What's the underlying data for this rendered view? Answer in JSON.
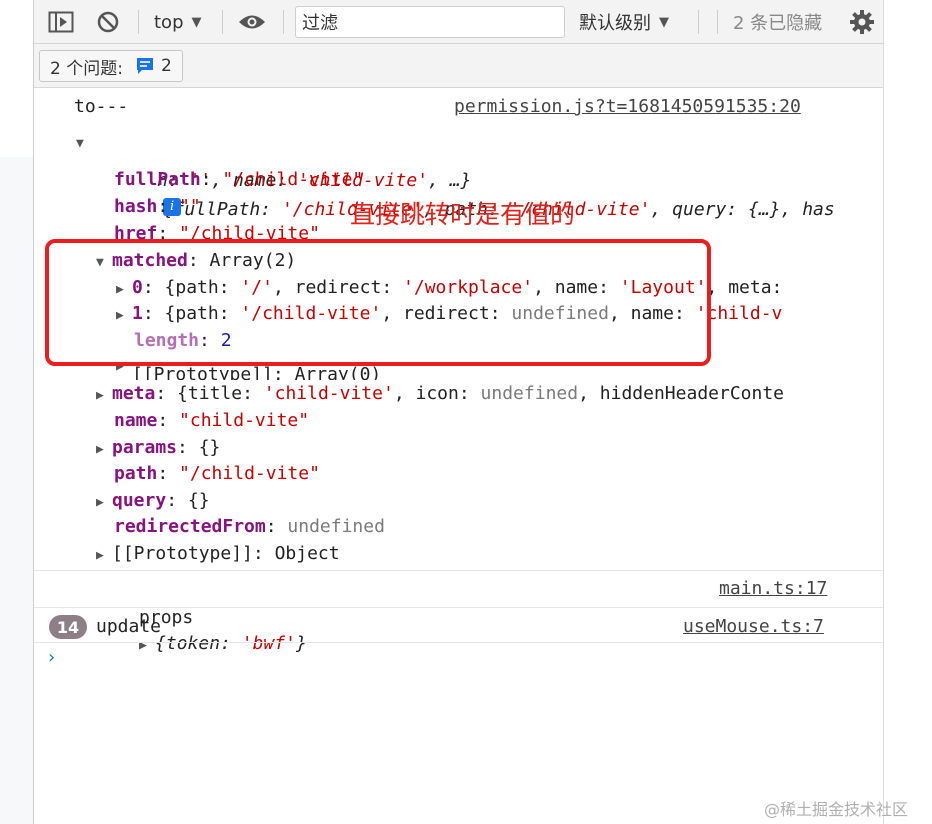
{
  "toolbar": {
    "context": "top",
    "filter_placeholder": "过滤",
    "levels": "默认级别",
    "hidden": "2 条已隐藏"
  },
  "issues": {
    "label": "2 个问题:",
    "count": "2"
  },
  "log": {
    "prefix": "to---",
    "source": "permission.js?t=1681450591535:20",
    "summary_line1_parts": [
      "{",
      "fullPath",
      ": ",
      "'/child-vite'",
      ", ",
      "path",
      ": ",
      "'/child-vite'",
      ", ",
      "query",
      ": {…}, ",
      "has"
    ],
    "summary_line2_parts": [
      "h",
      ": ",
      "''",
      ", ",
      "name",
      ": ",
      "'child-vite'",
      ", …}"
    ],
    "info_badge": "i",
    "props": [
      {
        "key": "fullPath",
        "value": "\"/child-vite\""
      },
      {
        "key": "hash",
        "value": "\"\""
      },
      {
        "key": "href",
        "value": "\"/child-vite\""
      }
    ],
    "matched": {
      "key": "matched",
      "value": "Array(2)"
    },
    "matched_items": [
      {
        "index": "0",
        "parts": [
          "{",
          "path",
          ": ",
          "'/'",
          ", ",
          "redirect",
          ": ",
          "'/workplace'",
          ", ",
          "name",
          ": ",
          "'Layout'",
          ", ",
          "meta",
          ":"
        ]
      },
      {
        "index": "1",
        "parts": [
          "{",
          "path",
          ": ",
          "'/child-vite'",
          ", ",
          "redirect",
          ": ",
          "undefined",
          ", ",
          "name",
          ": ",
          "'child-v"
        ]
      }
    ],
    "length": {
      "key": "length",
      "value": "2"
    },
    "proto_array": {
      "key": "[[Prototype]]",
      "value": "Array(0)"
    },
    "meta": {
      "key": "meta",
      "parts": [
        "{",
        "title",
        ": ",
        "'child-vite'",
        ", ",
        "icon",
        ": ",
        "undefined",
        ", ",
        "hiddenHeaderConte"
      ]
    },
    "name": {
      "key": "name",
      "value": "\"child-vite\""
    },
    "params": {
      "key": "params",
      "value": "{}"
    },
    "path": {
      "key": "path",
      "value": "\"/child-vite\""
    },
    "query": {
      "key": "query",
      "value": "{}"
    },
    "redirectedFrom": {
      "key": "redirectedFrom",
      "value": "undefined"
    },
    "proto_object": {
      "key": "[[Prototype]]",
      "value": "Object"
    }
  },
  "annotation": "直接跳转时是有值的",
  "props_log": {
    "prefix": "props",
    "parts": [
      "{",
      "token",
      ": ",
      "'bwf'",
      "}"
    ],
    "source": "main.ts:17"
  },
  "update_log": {
    "count": "14",
    "text": "update",
    "source": "useMouse.ts:7"
  },
  "prompt": "›",
  "watermark": "@稀土掘金技术社区",
  "colors": {
    "key": "#881280",
    "string": "#c80000",
    "number": "#1a1aa6",
    "undefined": "#7a7a7a",
    "annotation": "#e0221b",
    "link": "#1a73e8"
  }
}
